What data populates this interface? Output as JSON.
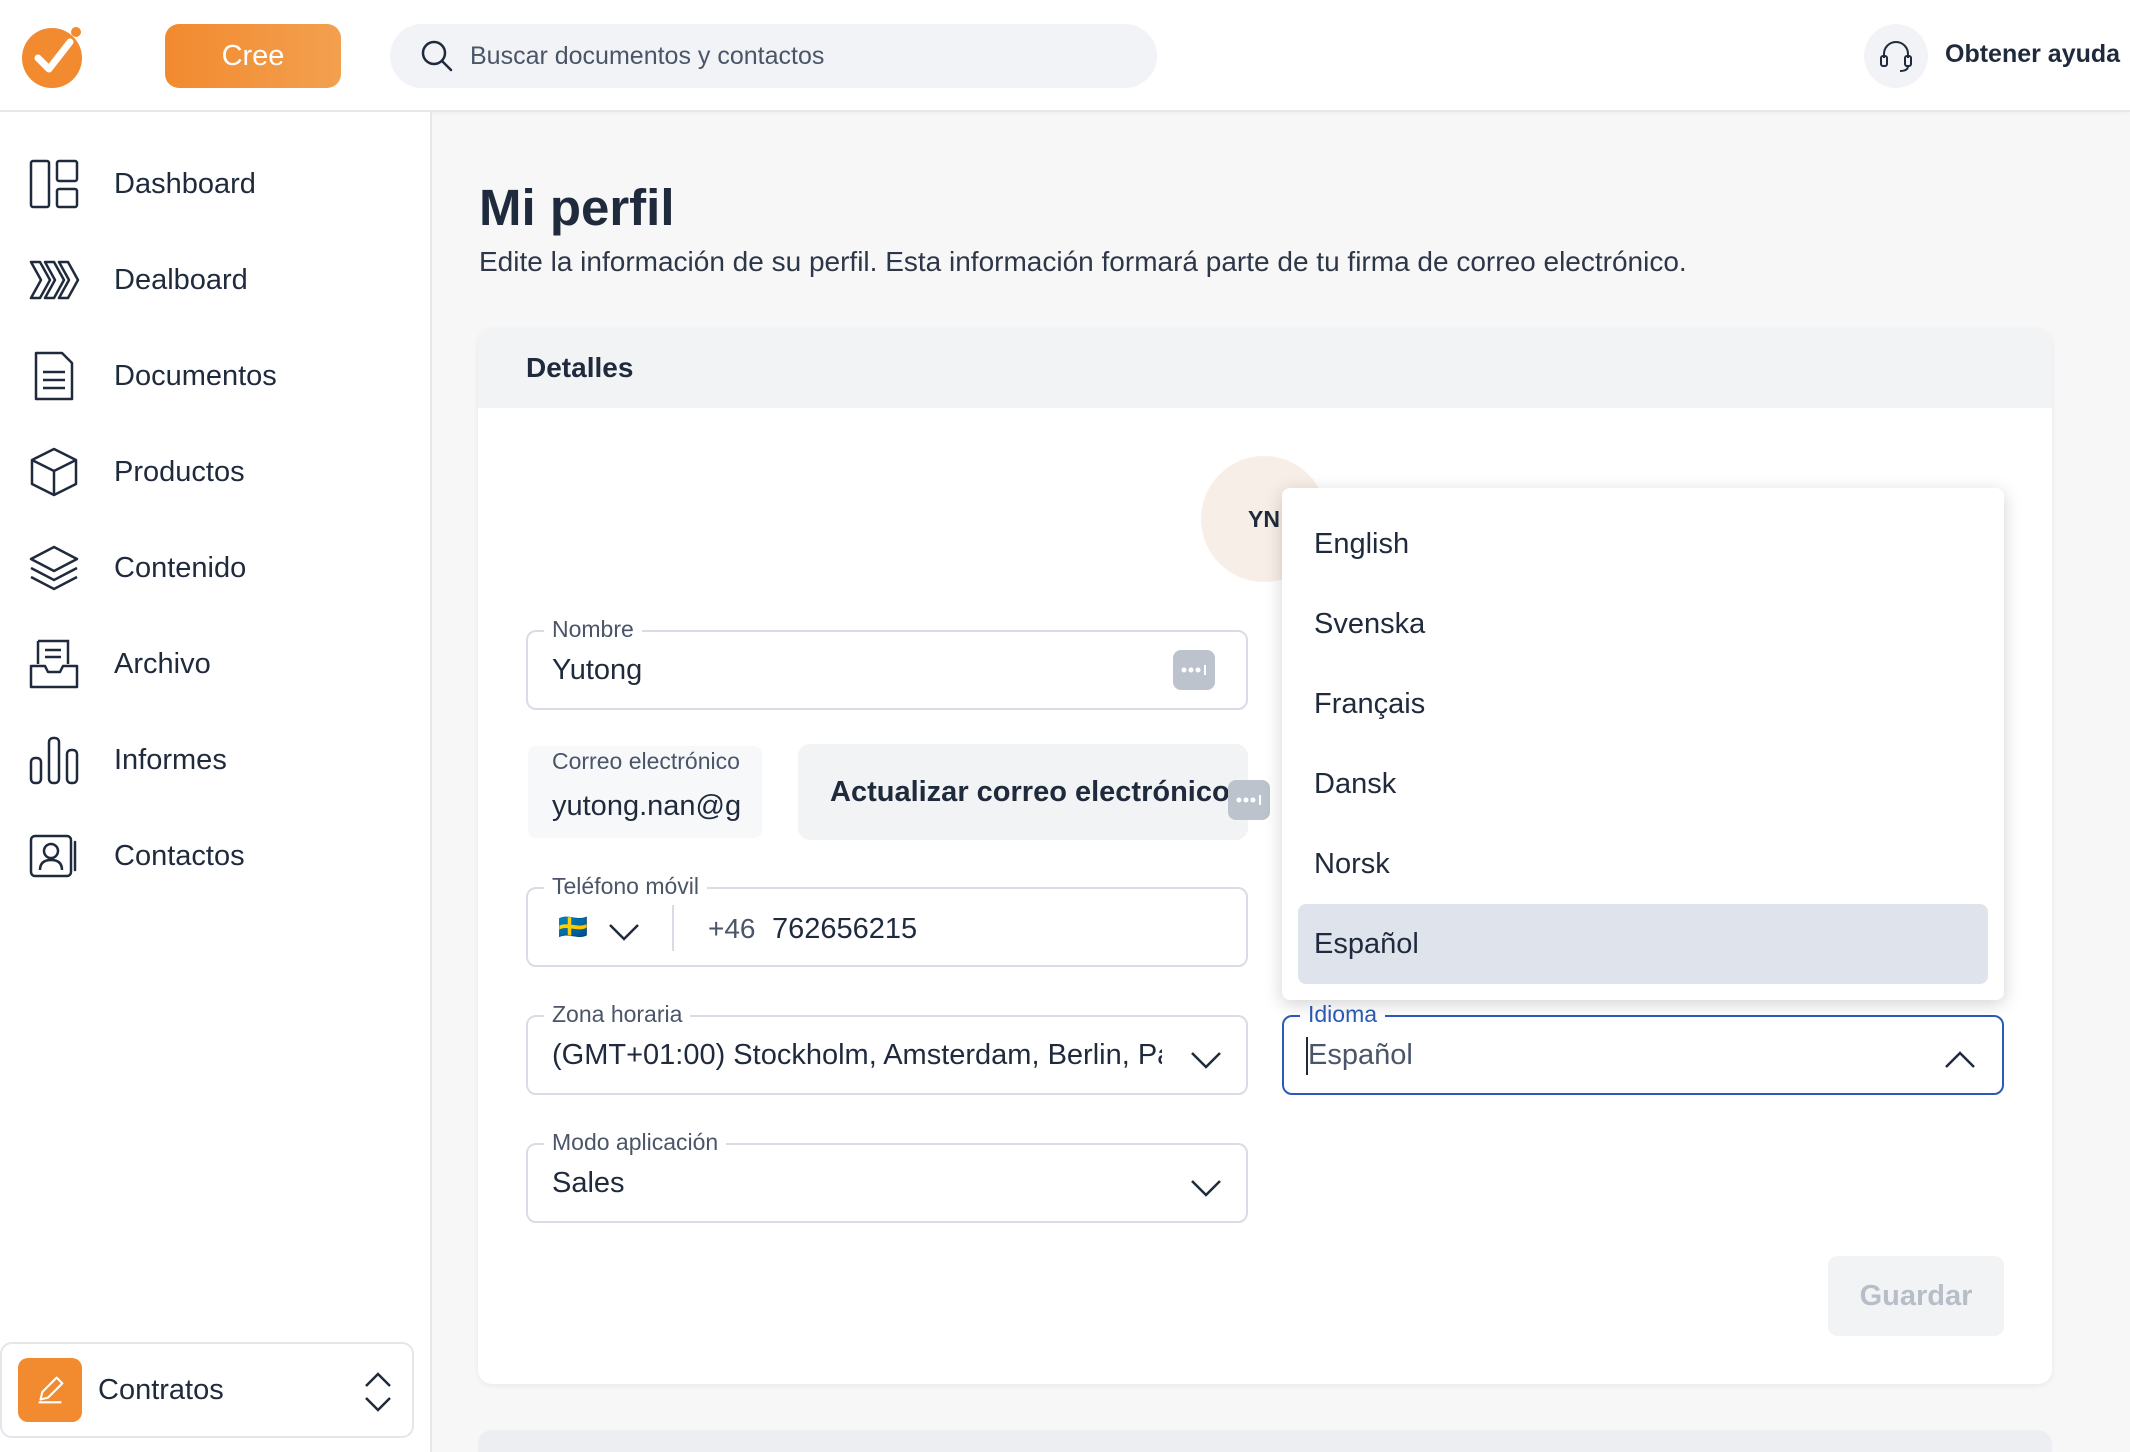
{
  "topbar": {
    "create_label": "Cree",
    "search_placeholder": "Buscar documentos y contactos",
    "help_label": "Obtener ayuda"
  },
  "sidebar": {
    "items": [
      {
        "label": "Dashboard",
        "icon": "dashboard-icon"
      },
      {
        "label": "Dealboard",
        "icon": "dealboard-icon"
      },
      {
        "label": "Documentos",
        "icon": "document-icon"
      },
      {
        "label": "Productos",
        "icon": "box-icon"
      },
      {
        "label": "Contenido",
        "icon": "layers-icon"
      },
      {
        "label": "Archivo",
        "icon": "archive-icon"
      },
      {
        "label": "Informes",
        "icon": "bar-chart-icon"
      },
      {
        "label": "Contactos",
        "icon": "contact-card-icon"
      }
    ],
    "workspace": {
      "label": "Contratos"
    }
  },
  "page": {
    "title": "Mi perfil",
    "subtitle": "Edite la información de su perfil. Esta información formará parte de tu firma de correo electrónico."
  },
  "card": {
    "title": "Detalles",
    "avatar_initials": "YN",
    "fields": {
      "name": {
        "label": "Nombre",
        "value": "Yutong"
      },
      "email": {
        "label": "Correo electrónico",
        "value": "yutong.nan@g"
      },
      "update_email_label": "Actualizar correo electrónico",
      "phone": {
        "label": "Teléfono móvil",
        "flag": "🇸🇪",
        "prefix": "+46",
        "number": "762656215"
      },
      "timezone": {
        "label": "Zona horaria",
        "value": "(GMT+01:00) Stockholm, Amsterdam, Berlin, Pa"
      },
      "app_mode": {
        "label": "Modo aplicación",
        "value": "Sales"
      },
      "language": {
        "label": "Idioma",
        "value": "Español"
      }
    },
    "save_label": "Guardar"
  },
  "language_dropdown": {
    "options": [
      "English",
      "Svenska",
      "Français",
      "Dansk",
      "Norsk",
      "Español"
    ],
    "selected": "Español"
  },
  "colors": {
    "accent": "#f28a2f",
    "focus": "#2a5bb7",
    "selected_option_bg": "#dfe4ec"
  }
}
